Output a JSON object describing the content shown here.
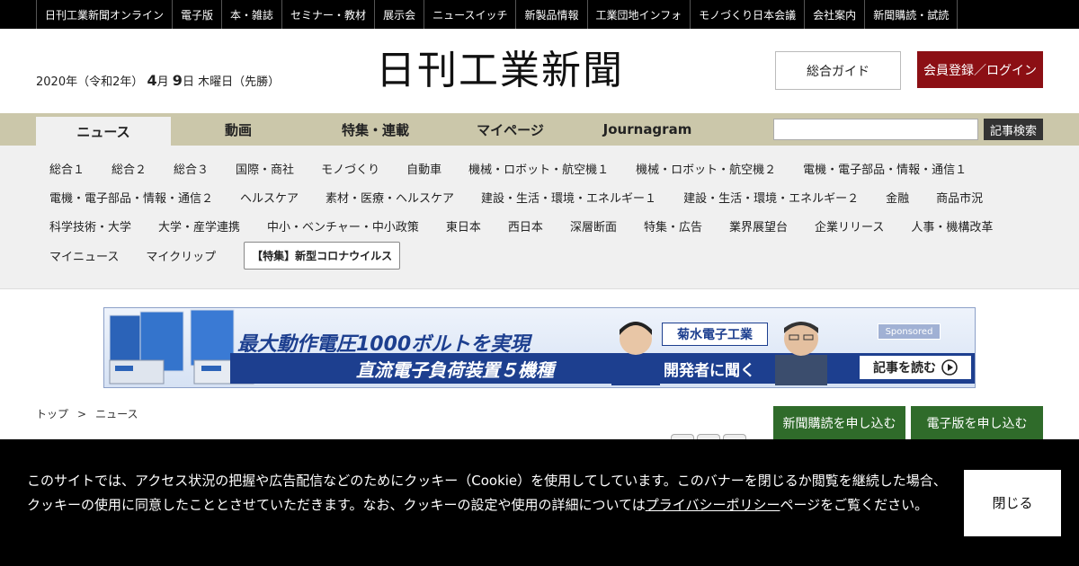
{
  "top_nav": [
    "日刊工業新聞オンライン",
    "電子版",
    "本・雑誌",
    "セミナー・教材",
    "展示会",
    "ニュースイッチ",
    "新製品情報",
    "工業団地インフォ",
    "モノづくり日本会議",
    "会社案内",
    "新聞購読・試読"
  ],
  "header": {
    "date_prefix": "2020年（令和2年）",
    "month": "4",
    "month_unit": "月",
    "day": "9",
    "day_suffix": "日 木曜日（先勝）",
    "logo_text": "日刊工業新聞",
    "guide_button": "総合ガイド",
    "login_button": "会員登録／ログイン"
  },
  "main_tabs": [
    "ニュース",
    "動画",
    "特集・連載",
    "マイページ",
    "Journagram"
  ],
  "search": {
    "placeholder": "",
    "button": "記事検索"
  },
  "categories": {
    "row1": [
      "総合１",
      "総合２",
      "総合３",
      "国際・商社",
      "モノづくり",
      "自動車",
      "機械・ロボット・航空機１",
      "機械・ロボット・航空機２",
      "電機・電子部品・情報・通信１"
    ],
    "row2": [
      "電機・電子部品・情報・通信２",
      "ヘルスケア",
      "素材・医療・ヘルスケア",
      "建設・生活・環境・エネルギー１",
      "建設・生活・環境・エネルギー２",
      "金融",
      "商品市況"
    ],
    "row3": [
      "科学技術・大学",
      "大学・産学連携",
      "中小・ベンチャー・中小政策",
      "東日本",
      "西日本",
      "深層断面",
      "特集・広告",
      "業界展望台",
      "企業リリース",
      "人事・機構改革"
    ],
    "row4": [
      "マイニュース",
      "マイクリップ"
    ],
    "featured": "【特集】新型コロナウイルス"
  },
  "ad": {
    "headline1": "最大動作電圧1000ボルトを実現",
    "headline2": "直流電子負荷装置５機種",
    "company": "菊水電子工業",
    "interview": "開発者に聞く",
    "sponsored": "Sponsored",
    "read_more": "記事を読む"
  },
  "breadcrumb": {
    "home": "トップ",
    "separator": ">",
    "current": "ニュース"
  },
  "subscribe": {
    "paper": "新聞購読を申し込む",
    "digital": "電子版を申し込む"
  },
  "cookie": {
    "text_before": "このサイトでは、アクセス状況の把握や広告配信などのためにクッキー（Cookie）を使用してしています。このバナーを閉じるか閲覧を継続した場合、クッキーの使用に同意したこととさせていただきます。なお、クッキーの設定や使用の詳細については",
    "link": "プライバシーポリシー",
    "text_after": "ページをご覧ください。",
    "close": "閉じる"
  },
  "colors": {
    "accent_red": "#8c0f14",
    "tab_bar": "#cbc7aa",
    "subscribe_green": "#2f6b2a",
    "ad_blue": "#1d3f8f"
  }
}
